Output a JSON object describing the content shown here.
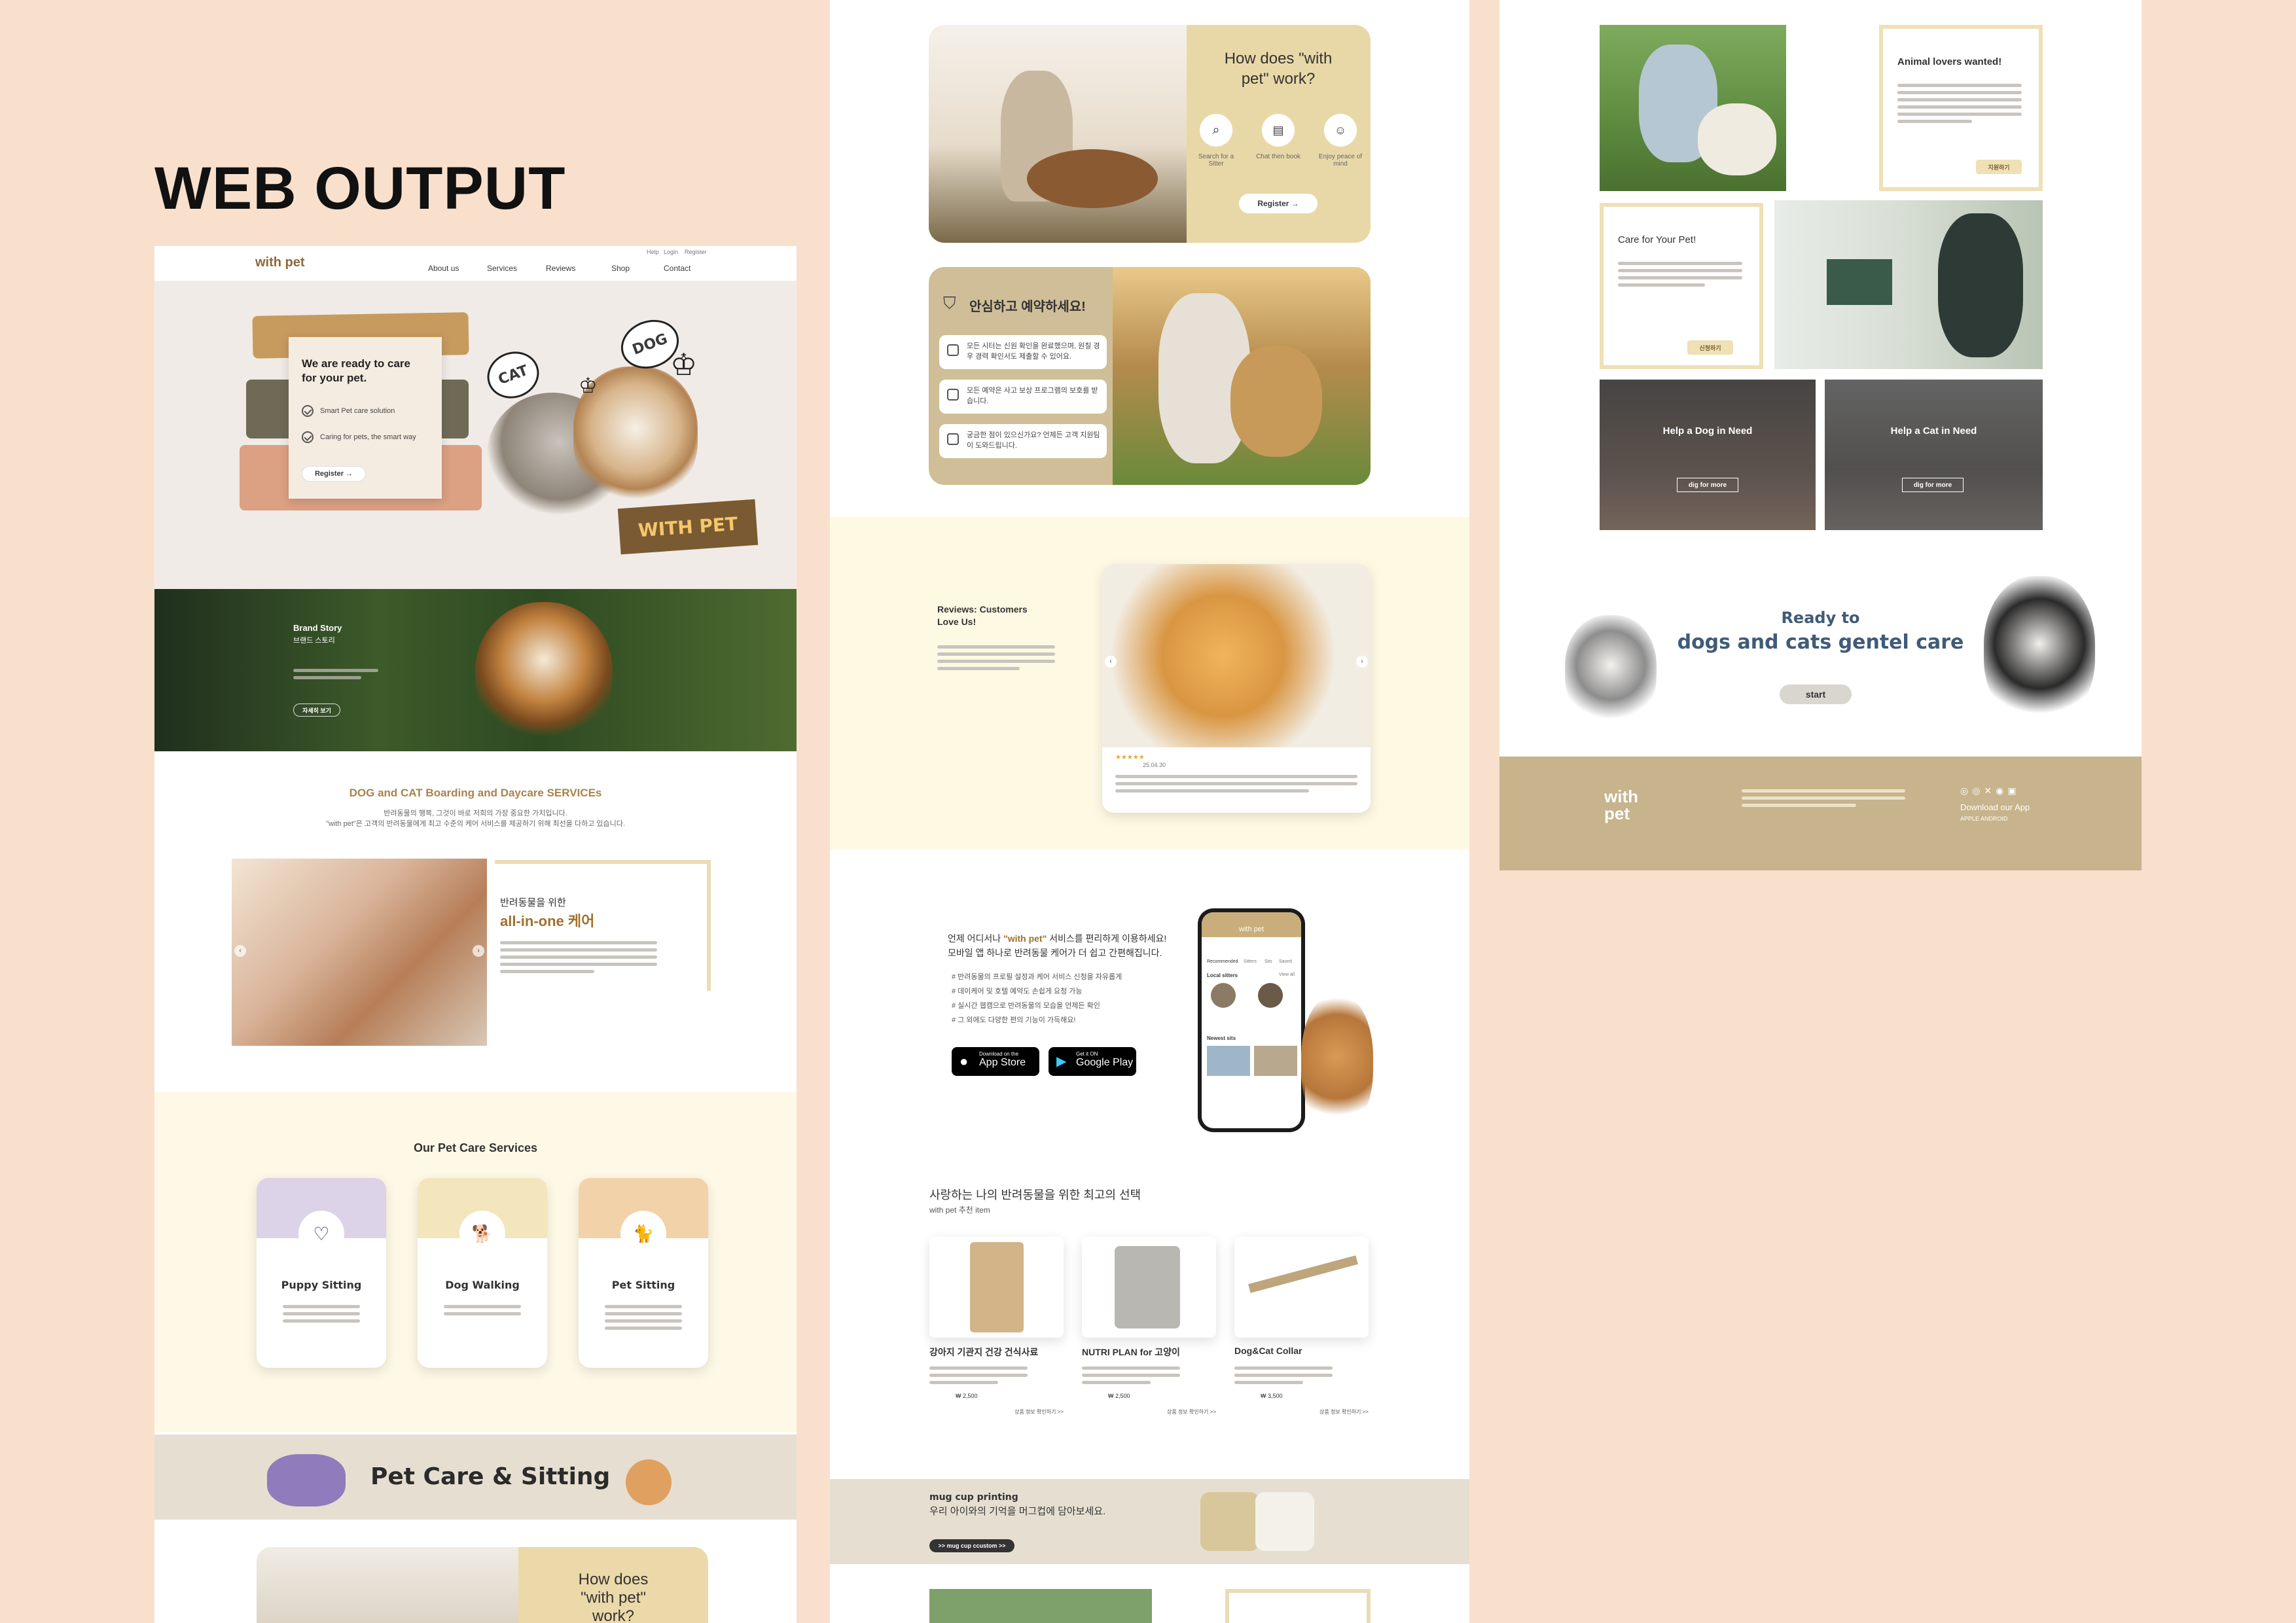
{
  "page_title": "WEB OUTPUT",
  "nav": {
    "logo": "with pet",
    "top_links": [
      "Help",
      "Login",
      "Register"
    ],
    "links": [
      "About us",
      "Services",
      "Reviews",
      "Shop",
      "Contact"
    ]
  },
  "hero": {
    "title": "We are ready to care for your pet.",
    "checks": [
      "Smart Pet care solution",
      "Caring for pets, the smart way"
    ],
    "register": "Register →",
    "badge_cat": "CAT",
    "badge_dog": "DOG",
    "brand_sticker": "WITH PET"
  },
  "brand_story": {
    "title": "Brand Story",
    "subtitle": "브랜드 스토리",
    "button": "자세히 보기"
  },
  "services_intro": {
    "title": "DOG and CAT Boarding and Daycare SERVICEs",
    "line1": "반려동물의 행복, 그것이 바로 저희의 가장 중요한 가치입니다.",
    "line2": "\"with pet\"은 고객의 반려동물에게 최고 수준의 케어 서비스를 제공하기 위해 최선을 다하고 있습니다."
  },
  "allinone": {
    "kicker": "반려동물을 위한",
    "title": "all-in-one 케어"
  },
  "care_services": {
    "title": "Our Pet Care Services",
    "cards": [
      {
        "name": "Puppy Sitting",
        "color": "#dcd3e8"
      },
      {
        "name": "Dog Walking",
        "color": "#f4e6bc"
      },
      {
        "name": "Pet Sitting",
        "color": "#f2d2a8"
      }
    ]
  },
  "banner1": {
    "title": "Pet Care & Sitting"
  },
  "how": {
    "title": "How does \"with pet\" work?",
    "steps": [
      "Search for a Sitter",
      "Chat then book",
      "Enjoy peace of mind"
    ],
    "register": "Register →"
  },
  "safe": {
    "title": "안심하고 예약하세요!",
    "items": [
      "모든 시터는 신원 확인을 완료했으며, 원칠 경우 경력 확인서도 제출할 수 있어요.",
      "모든 예약은 사고 보상 프로그램의 보호를 받습니다.",
      "궁금한 점이 있으신가요? 언제든 고객 지원팀이 도와드립니다."
    ]
  },
  "reviews": {
    "title": "Reviews: Customers Love Us!",
    "date": "25.04.30"
  },
  "app": {
    "headline_pre": "언제 어디서나 ",
    "headline_brand": "\"with pet\"",
    "headline_post": " 서비스를 편리하게 이용하세요!",
    "headline2": "모바일 앱 하나로 반려동물 케어가 더 쉽고 간편해집니다.",
    "bullets": [
      "# 반려동물의 프로필 설정과 케어 서비스 신청을 자유롭게",
      "# 데이케어 및 호텔 예약도 손쉽게 요청 가능",
      "# 실시간 웹캠으로 반려동물의 모습을 언제든 확인",
      "# 그 외에도 다양한 편의 기능이 가득해요!"
    ],
    "app_store_small": "Download on the",
    "app_store": "App Store",
    "google_small": "Get it ON",
    "google": "Google Play",
    "phone_title": "with pet",
    "phone_local": "Local sitters",
    "phone_newest": "Newest sits",
    "phone_view": "View all",
    "phone_tabs": [
      "Recommended",
      "Sitters",
      "Sits",
      "Saved"
    ]
  },
  "shop": {
    "title": "사랑하는 나의 반려동물을 위한 최고의 선택",
    "subtitle": "with pet 추천 item",
    "products": [
      {
        "name": "강아지 기관지 건강 건식사료",
        "price": "₩ 2,500",
        "link": "상품 정보 확인하기 >>"
      },
      {
        "name": "NUTRI PLAN for 고양이",
        "price": "₩ 2,500",
        "link": "상품 정보 확인하기 >>"
      },
      {
        "name": "Dog&Cat Collar",
        "price": "₩ 3,500",
        "link": "상품 정보 확인하기 >>"
      }
    ]
  },
  "mug": {
    "title": "mug cup printing",
    "subtitle": "우리 아이와의 기억을 머그컵에 담아보세요.",
    "button": ">> mug cup ccustom >>"
  },
  "animal": {
    "title": "Animal lovers wanted!",
    "button": "지원하기",
    "care_title": "Care for Your Pet!",
    "care_button": "신청하기"
  },
  "help": [
    {
      "title": "Help a Dog in Need",
      "button": "dig for more"
    },
    {
      "title": "Help a Cat in Need",
      "button": "dig for more"
    }
  ],
  "ready": {
    "line1": "Ready to",
    "line2": "dogs and cats gentel care",
    "button": "start"
  },
  "footer": {
    "logo": "with pet",
    "download": "Download our App",
    "stores": "APPLE   ANDROID"
  },
  "colors": {
    "bg": "#f9e0cd",
    "cream": "#fef9e6",
    "tan": "#c7b38c",
    "brown": "#8a5a2b",
    "beige_card": "#e3d2a6"
  }
}
